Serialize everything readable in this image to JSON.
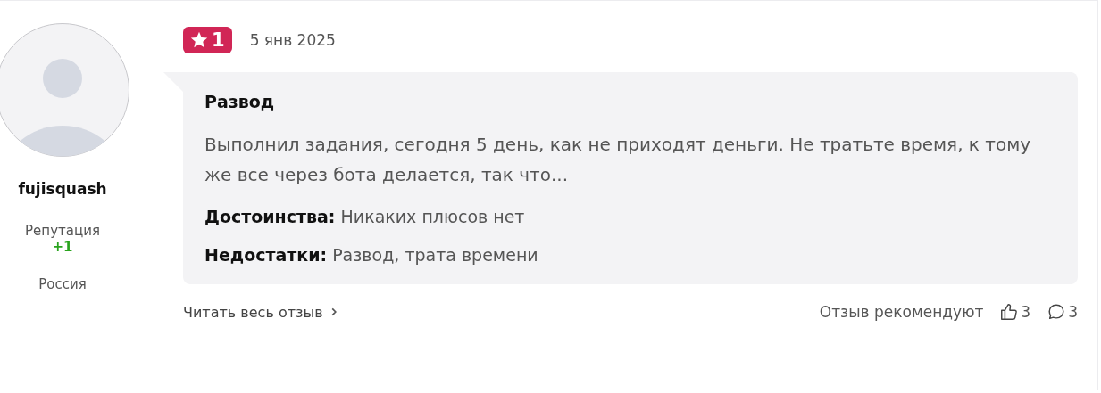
{
  "author": {
    "name": "fujisquash",
    "reputation_label": "Репутация",
    "reputation": "+1",
    "country": "Россия"
  },
  "review": {
    "rating": "1",
    "date": "5 янв 2025",
    "title": "Развод",
    "text": "Выполнил задания, сегодня 5 день, как не приходят деньги. Не тратьте время, к тому же все через бота делается, так что...",
    "sections": [
      {
        "label": "Достоинства:",
        "text": "Никаких плюсов нет"
      },
      {
        "label": "Недостатки:",
        "text": "Развод, трата времени"
      }
    ]
  },
  "footer": {
    "read_more": "Читать весь отзыв",
    "recommend_label": "Отзыв рекомендуют",
    "likes": "3",
    "comments": "3"
  }
}
